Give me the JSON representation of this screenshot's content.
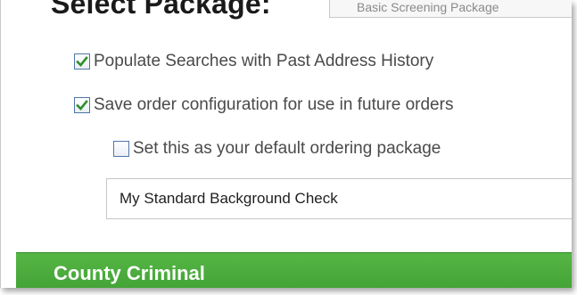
{
  "package": {
    "label": "Select Package:",
    "selected": "Basic Screening Package"
  },
  "options": [
    {
      "label": "Populate Searches with Past Address History",
      "checked": true
    },
    {
      "label": "Save order configuration for use in future orders",
      "checked": true
    },
    {
      "label": "Set this as your default ordering package",
      "checked": false
    }
  ],
  "config_name": {
    "value": "My Standard Background Check"
  },
  "section": {
    "title": "County Criminal"
  },
  "colors": {
    "accent_green": "#4aaa3b",
    "checkbox_border": "#4f77a6",
    "checkmark": "#2f8f2a"
  }
}
